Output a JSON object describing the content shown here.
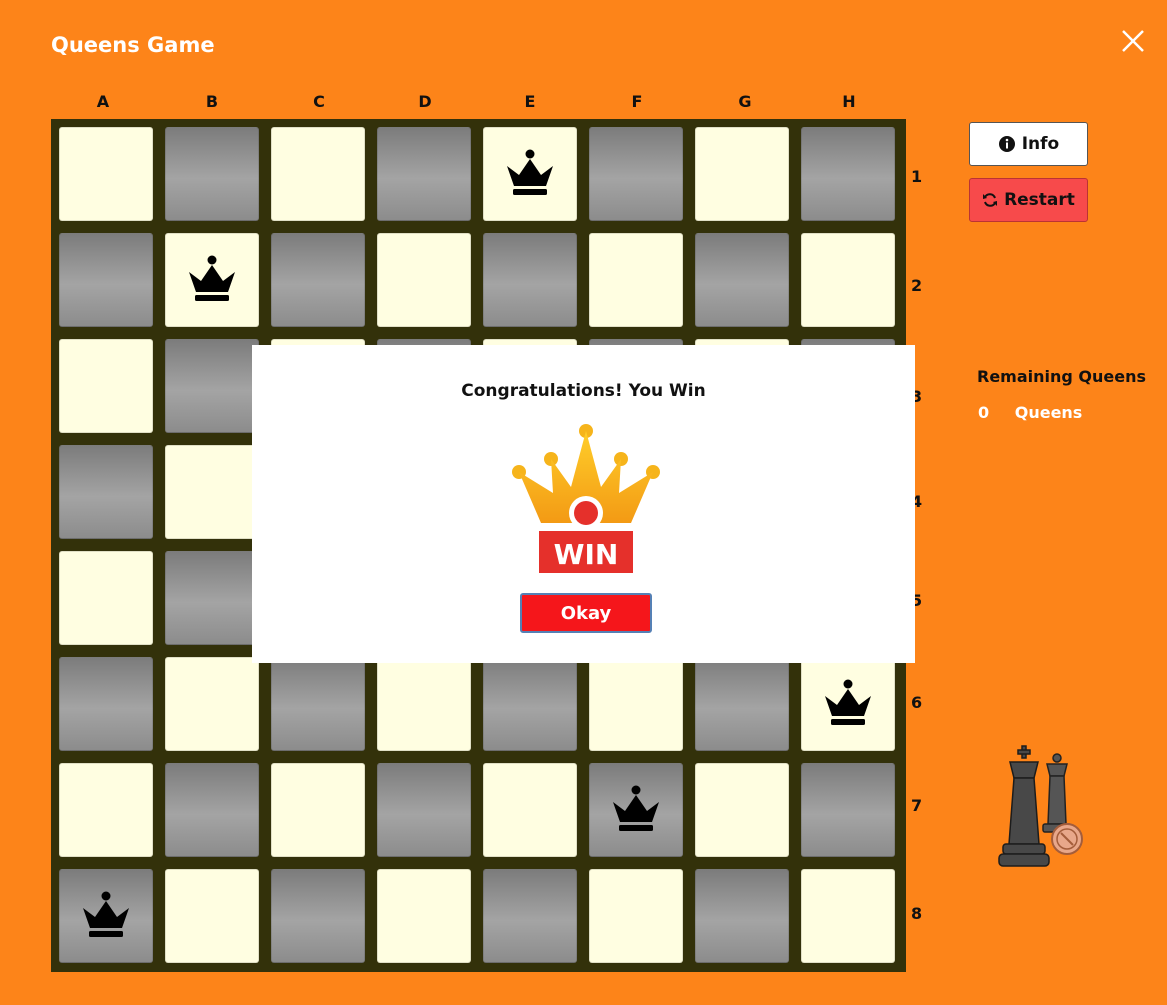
{
  "app": {
    "title": "Queens Game",
    "close_icon": "close-icon"
  },
  "board": {
    "columns": [
      "A",
      "B",
      "C",
      "D",
      "E",
      "F",
      "G",
      "H"
    ],
    "rows": [
      "1",
      "2",
      "3",
      "4",
      "5",
      "6",
      "7",
      "8"
    ],
    "colors": {
      "light": "#fffee1",
      "dark": "#8c8c8c",
      "border": "#33310a"
    },
    "queens": [
      "E1",
      "B2",
      "H6",
      "F7",
      "A8"
    ]
  },
  "controls": {
    "info_label": "Info",
    "info_icon": "info-icon",
    "restart_label": "Restart",
    "restart_icon": "refresh-icon"
  },
  "status": {
    "remaining_title": "Remaining Queens",
    "remaining_count": "0",
    "remaining_unit": "Queens"
  },
  "modal": {
    "message": "Congratulations! You Win",
    "badge_text": "WIN",
    "okay_label": "Okay"
  },
  "colors": {
    "background": "#fd8419",
    "accent_red": "#f5161b",
    "restart": "#f74a4b"
  }
}
